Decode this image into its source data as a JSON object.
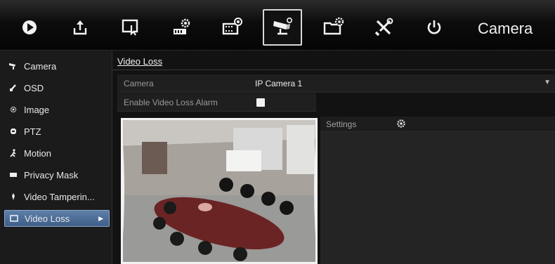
{
  "toolbar": {
    "items": [
      {
        "name": "play-button",
        "icon": "play-icon"
      },
      {
        "name": "export-button",
        "icon": "export-icon"
      },
      {
        "name": "manual-button",
        "icon": "manual-icon"
      },
      {
        "name": "hdd-button",
        "icon": "hdd-settings-icon"
      },
      {
        "name": "record-button",
        "icon": "record-settings-icon"
      },
      {
        "name": "camera-button",
        "icon": "camera-settings-icon",
        "active": true
      },
      {
        "name": "configuration-button",
        "icon": "folder-settings-icon"
      },
      {
        "name": "maintenance-button",
        "icon": "tools-icon"
      },
      {
        "name": "shutdown-button",
        "icon": "power-icon"
      }
    ],
    "title": "Camera"
  },
  "sidebar": {
    "items": [
      {
        "label": "Camera",
        "icon": "camera-icon"
      },
      {
        "label": "OSD",
        "icon": "osd-icon"
      },
      {
        "label": "Image",
        "icon": "image-icon"
      },
      {
        "label": "PTZ",
        "icon": "ptz-icon"
      },
      {
        "label": "Motion",
        "icon": "motion-icon"
      },
      {
        "label": "Privacy Mask",
        "icon": "privacy-mask-icon"
      },
      {
        "label": "Video Tamperin...",
        "icon": "tampering-icon"
      },
      {
        "label": "Video Loss",
        "icon": "video-loss-icon",
        "selected": true
      }
    ]
  },
  "main": {
    "section_title": "Video Loss",
    "camera_label": "Camera",
    "camera_value": "IP Camera 1",
    "alarm_label": "Enable Video Loss Alarm",
    "alarm_enabled": true,
    "settings_label": "Settings"
  },
  "colors": {
    "selected_gradient_top": "#5d7fa8",
    "selected_gradient_bottom": "#3e5f88",
    "panel_bg": "#121212"
  }
}
